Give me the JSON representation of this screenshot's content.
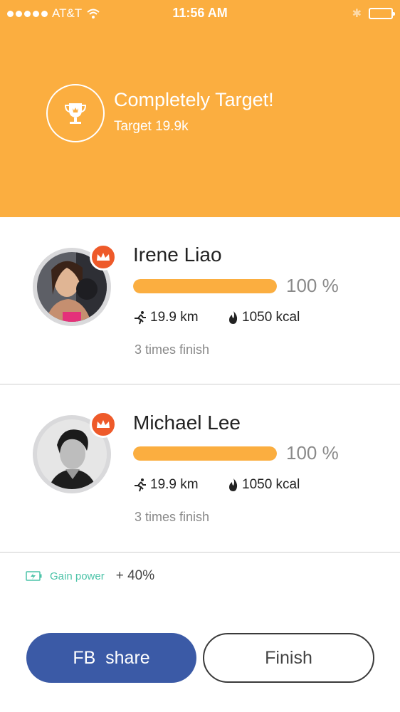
{
  "status_bar": {
    "carrier": "AT&T",
    "time": "11:56 AM",
    "signal_dots": 5,
    "wifi_icon": "wifi-icon",
    "bluetooth_icon": "bluetooth-icon",
    "battery_icon": "battery-icon"
  },
  "header": {
    "title": "Completely Target!",
    "subtitle": "Target 19.9k",
    "icon": "trophy-icon",
    "background_color": "#fbae40"
  },
  "users": [
    {
      "name": "Irene Liao",
      "progress_percent": 100,
      "percent_label": "100 %",
      "distance": "19.9 km",
      "calories": "1050 kcal",
      "times": "3 times finish",
      "badge": "crown-icon"
    },
    {
      "name": "Michael Lee",
      "progress_percent": 100,
      "percent_label": "100 %",
      "distance": "19.9 km",
      "calories": "1050 kcal",
      "times": "3 times finish",
      "badge": "crown-icon"
    }
  ],
  "gain": {
    "label": "Gain power",
    "value": "+ 40%",
    "icon": "battery-charge-icon"
  },
  "buttons": {
    "fb_share": "FB  share",
    "finish": "Finish"
  },
  "colors": {
    "accent": "#fbae40",
    "crown": "#ee5a2a",
    "facebook": "#3b5aa6",
    "gain": "#4cc3a8"
  }
}
